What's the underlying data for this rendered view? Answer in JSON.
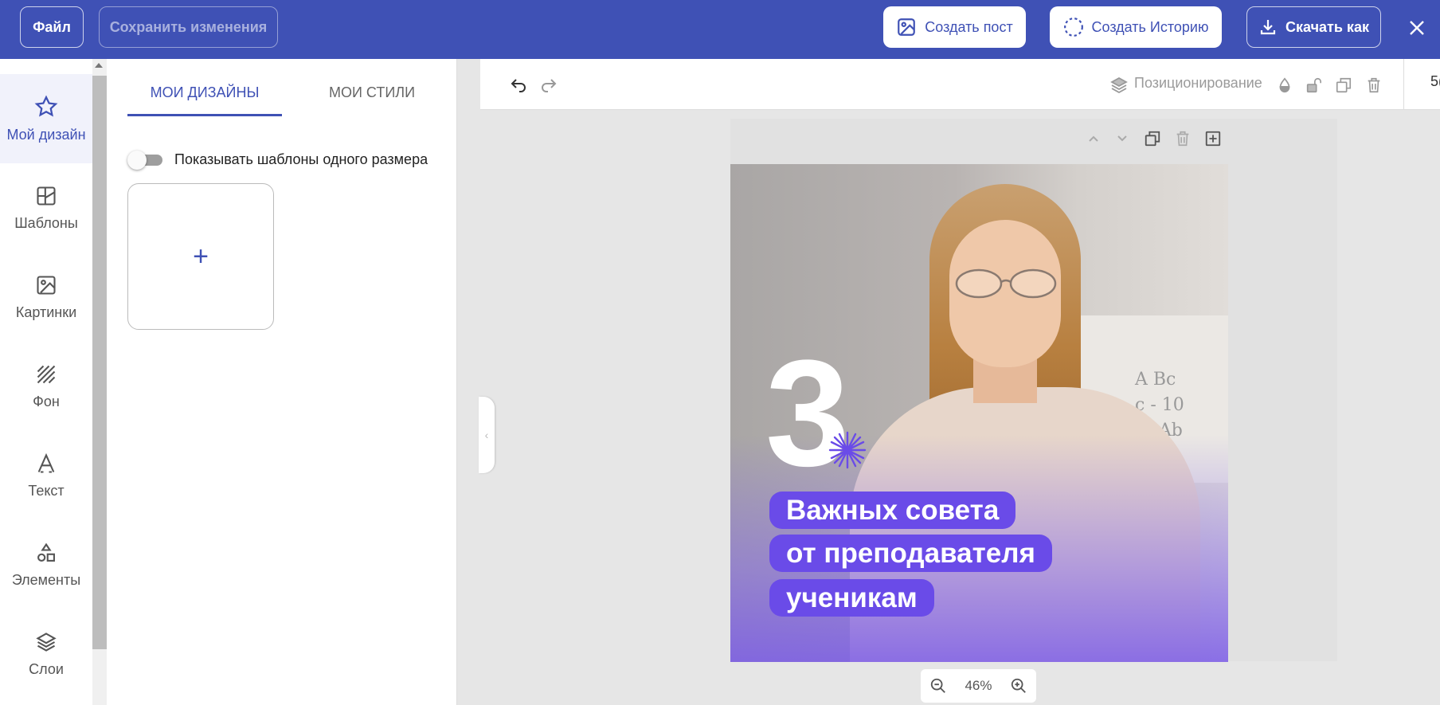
{
  "topbar": {
    "file_label": "Файл",
    "save_label": "Сохранить изменения",
    "create_post_label": "Создать пост",
    "create_story_label": "Создать Историю",
    "download_label": "Скачать как"
  },
  "rail": {
    "items": [
      {
        "label": "Мой дизайн",
        "icon": "star-icon"
      },
      {
        "label": "Шаблоны",
        "icon": "template-icon"
      },
      {
        "label": "Картинки",
        "icon": "image-icon"
      },
      {
        "label": "Фон",
        "icon": "background-stripes-icon"
      },
      {
        "label": "Текст",
        "icon": "text-icon"
      },
      {
        "label": "Элементы",
        "icon": "shapes-icon"
      },
      {
        "label": "Слои",
        "icon": "layers-icon"
      }
    ]
  },
  "panel": {
    "tabs": [
      "МОИ ДИЗАЙНЫ",
      "МОИ СТИЛИ"
    ],
    "toggle_label": "Показывать шаблоны одного размера",
    "add_symbol": "+"
  },
  "toolbar": {
    "positioning_label": "Позиционирование",
    "cut_text": "5("
  },
  "design": {
    "number": "3",
    "lines": [
      "Важных совета",
      "от преподавателя",
      "ученикам"
    ],
    "whiteboard_text": "A Bc\nc - 10\nAl Ab\n- b\nB"
  },
  "zoom": {
    "value": "46%"
  },
  "colors": {
    "brand": "#3f51b5",
    "pill": "#6a4be8",
    "burst": "#6a4be8"
  }
}
